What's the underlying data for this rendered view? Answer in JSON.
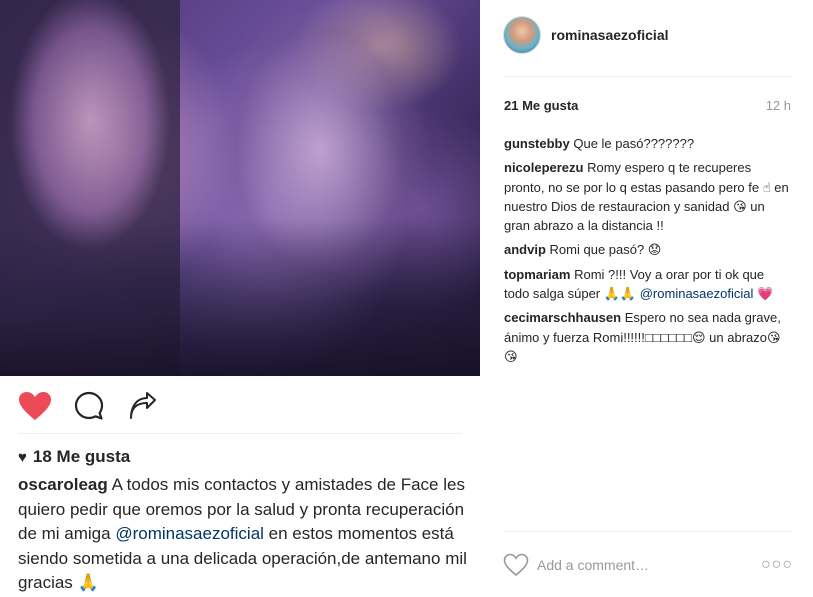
{
  "post": {
    "photo_icon": "selfie-photo",
    "liked": true,
    "accent_colors": {
      "like": "#ed4956",
      "link": "#003569",
      "muted": "#999999"
    }
  },
  "left": {
    "likes": "18 Me gusta",
    "caption_user": "oscaroleag",
    "caption_text_1": "A todos mis contactos y amistades de Face les quiero pedir que oremos por la salud y pronta recuperación de mi amiga ",
    "caption_mention": "@rominasaezoficial",
    "caption_text_2": " en estos momentos está siendo sometida a una delicada operación,de antemano mil gracias 🙏"
  },
  "right": {
    "header_user": "rominasaezoficial",
    "likes": "21 Me gusta",
    "time": "12 h",
    "comments": [
      {
        "user": "gunstebby",
        "text": "Que le pasó???????"
      },
      {
        "user": "nicoleperezu",
        "text": "Romy espero q te recuperes pronto, no se por lo q estas pasando pero fe ☝ en nuestro Dios de restauracion y sanidad 😘 un gran abrazo a la distancia !!"
      },
      {
        "user": "andvip",
        "text": "Romi que pasó? 😟"
      },
      {
        "user": "topmariam",
        "text": "Romi ?!!! Voy a orar por ti ok que todo salga súper 🙏🙏",
        "mention": "@rominasaezoficial",
        "after": " 💗"
      },
      {
        "user": "cecimarschhausen",
        "text": "Espero no sea nada grave, ánimo y fuerza Romi!!!!!!□□□□□□😌 un abrazo😘😘"
      }
    ],
    "add_comment_placeholder": "Add a comment…",
    "more_label": "○○○"
  }
}
